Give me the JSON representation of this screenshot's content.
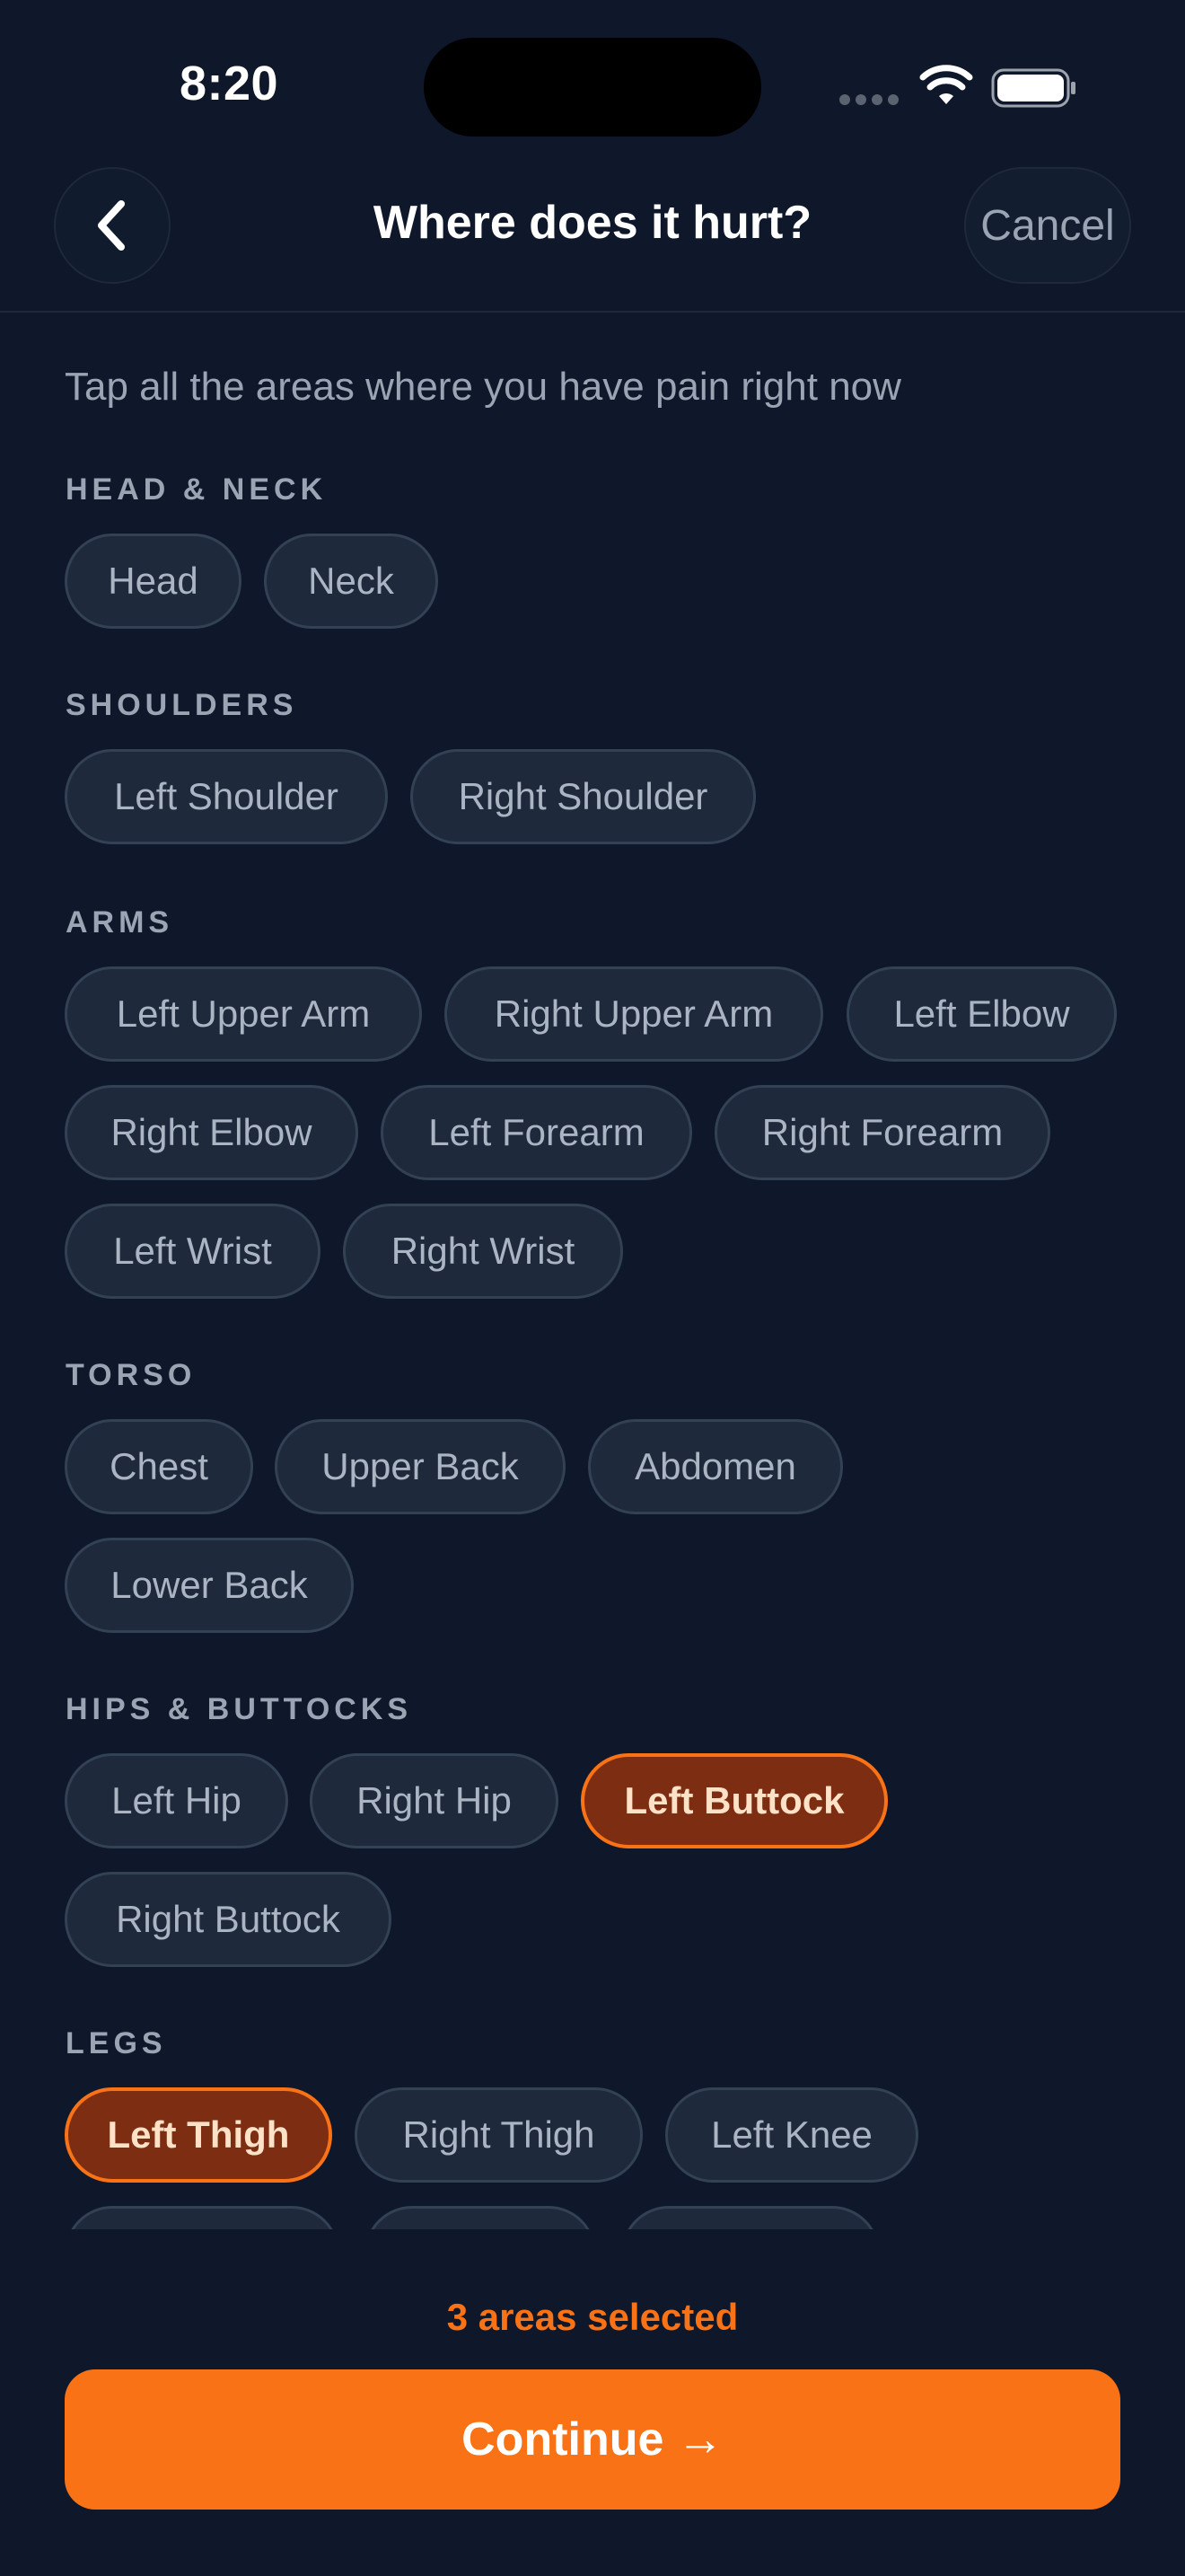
{
  "status_bar": {
    "time": "8:20"
  },
  "nav": {
    "title": "Where does it hurt?",
    "cancel_label": "Cancel",
    "back_icon": "chevron-left-icon"
  },
  "subtitle": "Tap all the areas where you have pain right now",
  "sections": [
    {
      "label": "HEAD & NECK",
      "chips": [
        {
          "label": "Head",
          "selected": false
        },
        {
          "label": "Neck",
          "selected": false
        }
      ]
    },
    {
      "label": "SHOULDERS",
      "chips": [
        {
          "label": "Left Shoulder",
          "selected": false
        },
        {
          "label": "Right Shoulder",
          "selected": false
        }
      ]
    },
    {
      "label": "ARMS",
      "chips": [
        {
          "label": "Left Upper Arm",
          "selected": false
        },
        {
          "label": "Right Upper Arm",
          "selected": false
        },
        {
          "label": "Left Elbow",
          "selected": false
        },
        {
          "label": "Right Elbow",
          "selected": false
        },
        {
          "label": "Left Forearm",
          "selected": false
        },
        {
          "label": "Right Forearm",
          "selected": false
        },
        {
          "label": "Left Wrist",
          "selected": false
        },
        {
          "label": "Right Wrist",
          "selected": false
        }
      ]
    },
    {
      "label": "TORSO",
      "chips": [
        {
          "label": "Chest",
          "selected": false
        },
        {
          "label": "Upper Back",
          "selected": false
        },
        {
          "label": "Abdomen",
          "selected": false
        },
        {
          "label": "Lower Back",
          "selected": false
        }
      ]
    },
    {
      "label": "HIPS & BUTTOCKS",
      "chips": [
        {
          "label": "Left Hip",
          "selected": false
        },
        {
          "label": "Right Hip",
          "selected": false
        },
        {
          "label": "Left Buttock",
          "selected": true
        },
        {
          "label": "Right Buttock",
          "selected": false
        }
      ]
    },
    {
      "label": "LEGS",
      "chips": [
        {
          "label": "Left Thigh",
          "selected": true
        },
        {
          "label": "Right Thigh",
          "selected": false
        },
        {
          "label": "Left Knee",
          "selected": false
        }
      ]
    }
  ],
  "footer": {
    "selected_count": "3 areas selected",
    "continue_label": "Continue →"
  },
  "colors": {
    "background": "#0f172a",
    "chip": "#1e293b",
    "accent": "#f97316",
    "selected_chip": "#7c2d12"
  }
}
